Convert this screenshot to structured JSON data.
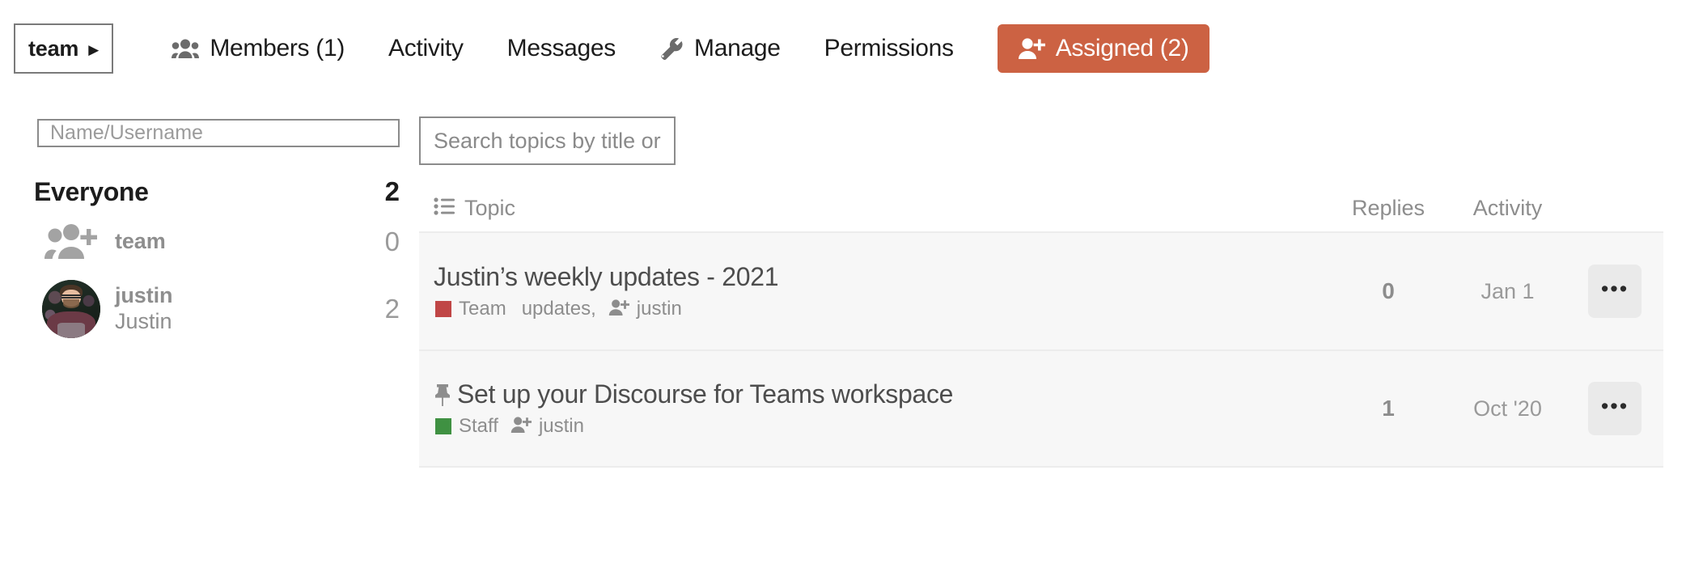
{
  "topnav": {
    "team_switcher": {
      "label": "team",
      "caret": "▶",
      "icon": "chevron-right-icon"
    },
    "items": [
      {
        "id": "members",
        "label": "Members (1)",
        "icon": "users-group-icon",
        "active": false
      },
      {
        "id": "activity",
        "label": "Activity",
        "icon": "",
        "active": false
      },
      {
        "id": "messages",
        "label": "Messages",
        "icon": "",
        "active": false
      },
      {
        "id": "manage",
        "label": "Manage",
        "icon": "wrench-icon",
        "active": false
      },
      {
        "id": "permissions",
        "label": "Permissions",
        "icon": "",
        "active": false
      },
      {
        "id": "assigned",
        "label": "Assigned (2)",
        "icon": "user-plus-icon",
        "active": true
      }
    ],
    "active_color": "#cc6243"
  },
  "sidebar": {
    "filter": {
      "placeholder": "Name/Username",
      "value": ""
    },
    "everyone": {
      "label": "Everyone",
      "count": "2"
    },
    "members": [
      {
        "username": "team",
        "fullname": "",
        "count": "0",
        "avatar": "group-plus-icon"
      },
      {
        "username": "justin",
        "fullname": "Justin",
        "count": "2",
        "avatar": "photo-avatar"
      }
    ]
  },
  "main": {
    "search": {
      "placeholder": "Search topics by title or ...",
      "value": ""
    },
    "columns": {
      "topic": "Topic",
      "topic_icon": "list-icon",
      "replies": "Replies",
      "activity": "Activity"
    },
    "rows": [
      {
        "title": "Justin’s weekly updates - 2021",
        "pinned": false,
        "category": {
          "name": "Team",
          "color": "#c04646"
        },
        "tags": [
          "updates,"
        ],
        "assignee": {
          "name": "justin",
          "icon": "user-plus-icon"
        },
        "replies": "0",
        "activity": "Jan 1",
        "actions_label": "•••"
      },
      {
        "title": "Set up your Discourse for Teams workspace",
        "pinned": true,
        "pin_icon": "pin-icon",
        "category": {
          "name": "Staff",
          "color": "#3f9142"
        },
        "tags": [],
        "assignee": {
          "name": "justin",
          "icon": "user-plus-icon"
        },
        "replies": "1",
        "activity": "Oct '20",
        "actions_label": "•••"
      }
    ]
  }
}
